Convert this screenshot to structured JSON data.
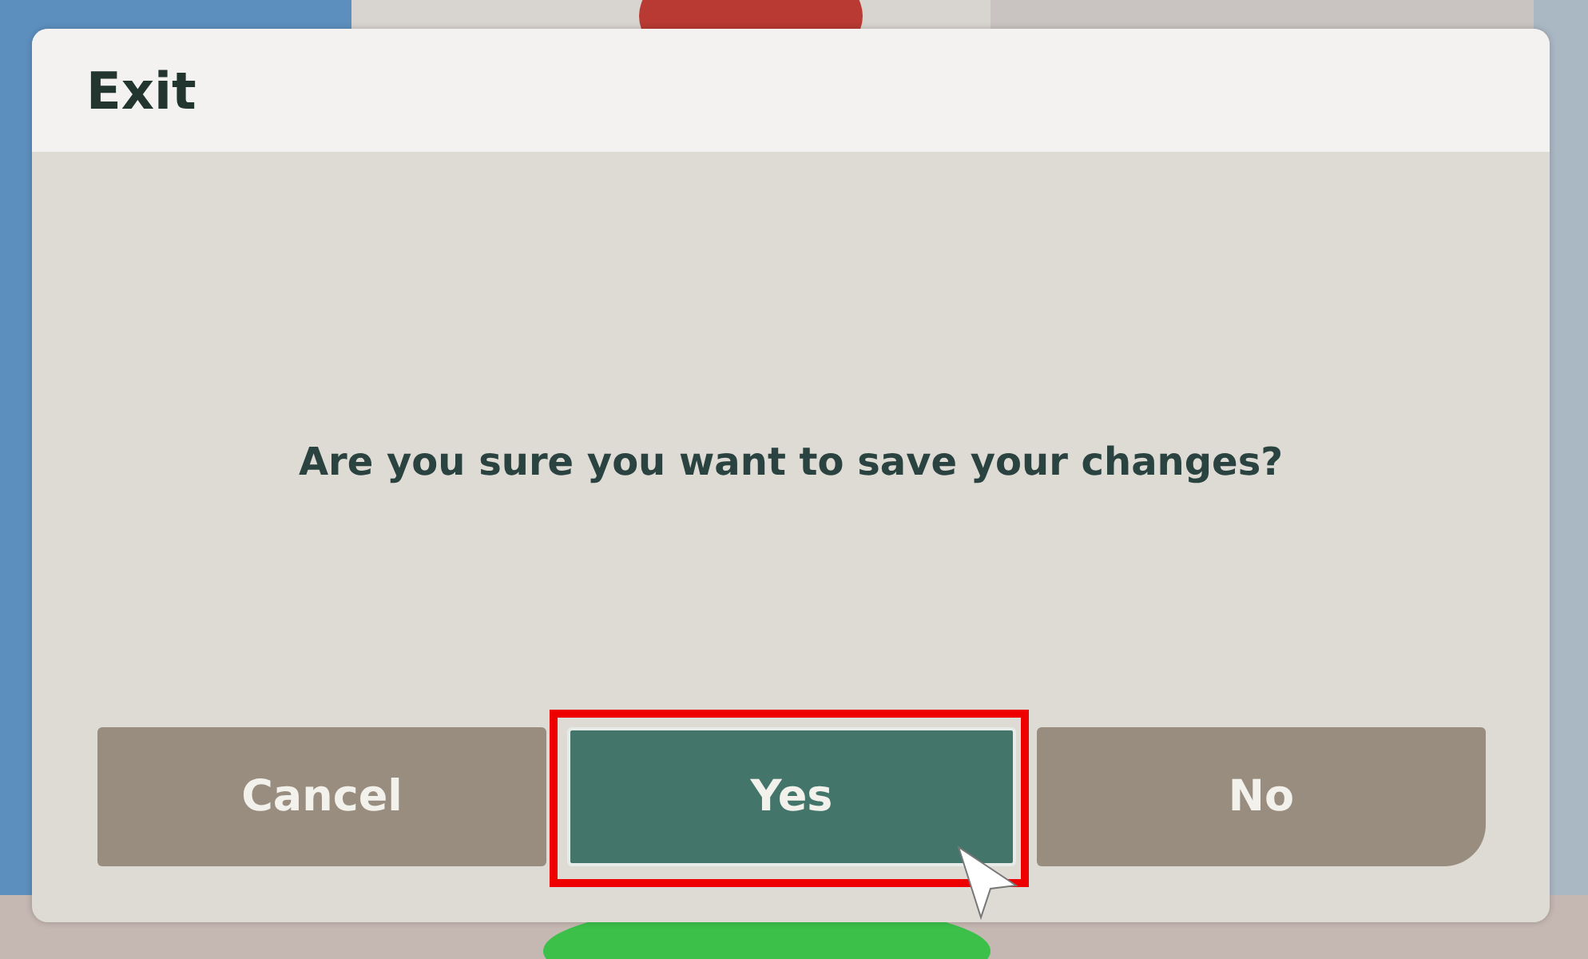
{
  "dialog": {
    "title": "Exit",
    "message": "Are you sure you want to save your changes?",
    "buttons": [
      {
        "label": "Cancel",
        "selected": false
      },
      {
        "label": "Yes",
        "selected": true
      },
      {
        "label": "No",
        "selected": false
      }
    ]
  }
}
